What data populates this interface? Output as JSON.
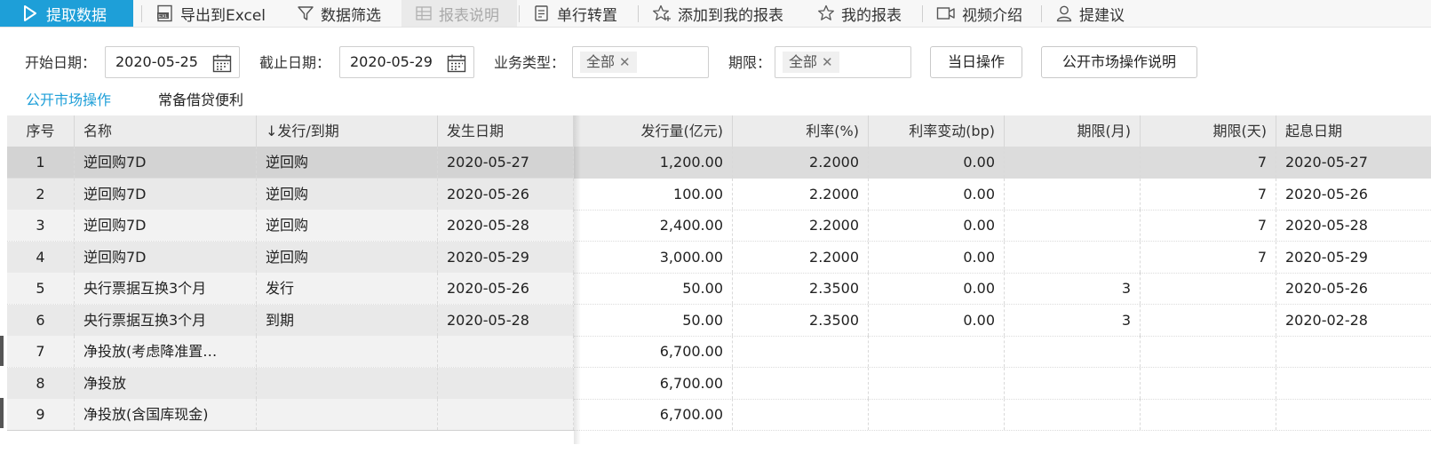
{
  "toolbar": {
    "fetch": "提取数据",
    "export": "导出到Excel",
    "filter": "数据筛选",
    "report_desc": "报表说明",
    "transpose": "单行转置",
    "add_to_my_reports": "添加到我的报表",
    "my_reports": "我的报表",
    "video_intro": "视频介绍",
    "suggest": "提建议"
  },
  "filters": {
    "start_label": "开始日期：",
    "start_date": "2020-05-25",
    "end_label": "截止日期：",
    "end_date": "2020-05-29",
    "type_label": "业务类型：",
    "type_tag": "全部",
    "term_label": "期限：",
    "term_tag": "全部",
    "today_button": "当日操作",
    "explain_button": "公开市场操作说明"
  },
  "tabs": [
    {
      "label": "公开市场操作",
      "active": true
    },
    {
      "label": "常备借贷便利",
      "active": false
    }
  ],
  "table": {
    "columns": [
      "序号",
      "名称",
      "↓发行/到期",
      "发生日期",
      "发行量(亿元)",
      "利率(%)",
      "利率变动(bp)",
      "期限(月)",
      "期限(天)",
      "起息日期"
    ],
    "rows": [
      [
        "1",
        "逆回购7D",
        "逆回购",
        "2020-05-27",
        "1,200.00",
        "2.2000",
        "0.00",
        "",
        "7",
        "2020-05-27"
      ],
      [
        "2",
        "逆回购7D",
        "逆回购",
        "2020-05-26",
        "100.00",
        "2.2000",
        "0.00",
        "",
        "7",
        "2020-05-26"
      ],
      [
        "3",
        "逆回购7D",
        "逆回购",
        "2020-05-28",
        "2,400.00",
        "2.2000",
        "0.00",
        "",
        "7",
        "2020-05-28"
      ],
      [
        "4",
        "逆回购7D",
        "逆回购",
        "2020-05-29",
        "3,000.00",
        "2.2000",
        "0.00",
        "",
        "7",
        "2020-05-29"
      ],
      [
        "5",
        "央行票据互换3个月",
        "发行",
        "2020-05-26",
        "50.00",
        "2.3500",
        "0.00",
        "3",
        "",
        "2020-05-26"
      ],
      [
        "6",
        "央行票据互换3个月",
        "到期",
        "2020-05-28",
        "50.00",
        "2.3500",
        "0.00",
        "3",
        "",
        "2020-02-28"
      ],
      [
        "7",
        "净投放(考虑降准置…",
        "",
        "",
        "6,700.00",
        "",
        "",
        "",
        "",
        ""
      ],
      [
        "8",
        "净投放",
        "",
        "",
        "6,700.00",
        "",
        "",
        "",
        "",
        ""
      ],
      [
        "9",
        "净投放(含国库现金)",
        "",
        "",
        "6,700.00",
        "",
        "",
        "",
        "",
        ""
      ]
    ],
    "selected_row": 0
  },
  "colors": {
    "accent": "#1e9fd8",
    "selected_row": "#dcdcdc"
  }
}
